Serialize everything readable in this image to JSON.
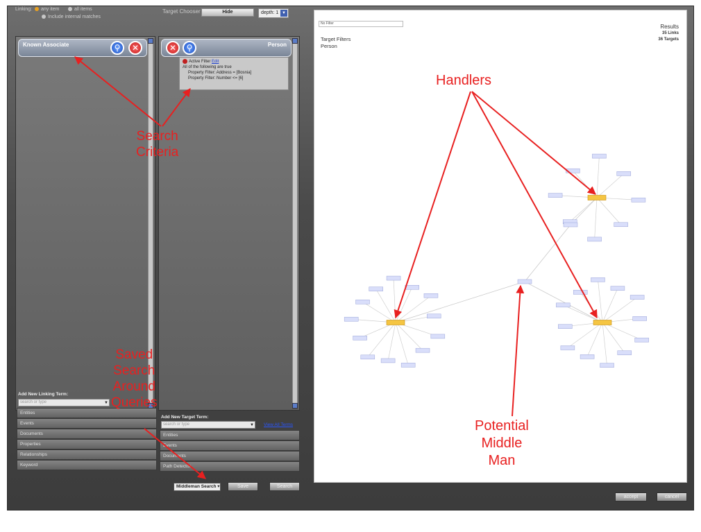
{
  "top": {
    "linking_label": "Linking:",
    "any_item": "any item",
    "all_items": "all items",
    "include_internal": "Include internal matches",
    "target_chooser": "Target Chooser",
    "hide_button": "Hide",
    "depth": "depth: 1"
  },
  "left_column": {
    "title": "Known Associate",
    "add_term_label": "Add New Linking Term:",
    "search_placeholder": "search or type"
  },
  "right_column": {
    "title": "Person",
    "filter": {
      "active_label": "Active Filter",
      "edit_link": "Edit",
      "line1": "All of the following are true",
      "line2": "Property Filter: Address = [Bosnia]",
      "line3": "Property Filter: Number <= [6]"
    },
    "add_term_label": "Add New Target Term:",
    "search_placeholder": "search or type",
    "view_all_terms": "View All Terms"
  },
  "left_categories": [
    "Entities",
    "Events",
    "Documents",
    "Properties",
    "Relationships",
    "Keyword"
  ],
  "right_categories": [
    "Entities",
    "Events",
    "Documents",
    "Path Detector"
  ],
  "bottom": {
    "saved_search": "Middleman Search",
    "save_button": "Save",
    "search_button": "Search",
    "accept_button": "accept",
    "cancel_button": "cancel"
  },
  "graph": {
    "filter_placeholder": "No Filter",
    "target_filters": "Target Filters",
    "person": "Person",
    "results_label": "Results",
    "links": "35 Links",
    "targets": "36 Targets"
  },
  "annotations": {
    "search_criteria": [
      "Search",
      "Criteria"
    ],
    "saved_queries": [
      "Saved",
      "Search",
      "Around",
      "Queries"
    ],
    "handlers": "Handlers",
    "potential": [
      "Potential",
      "Middle",
      "Man"
    ]
  },
  "colors": {
    "annotation_red": "#e82020",
    "hub_node": "#f5c542",
    "leaf_node": "#d9defa"
  }
}
